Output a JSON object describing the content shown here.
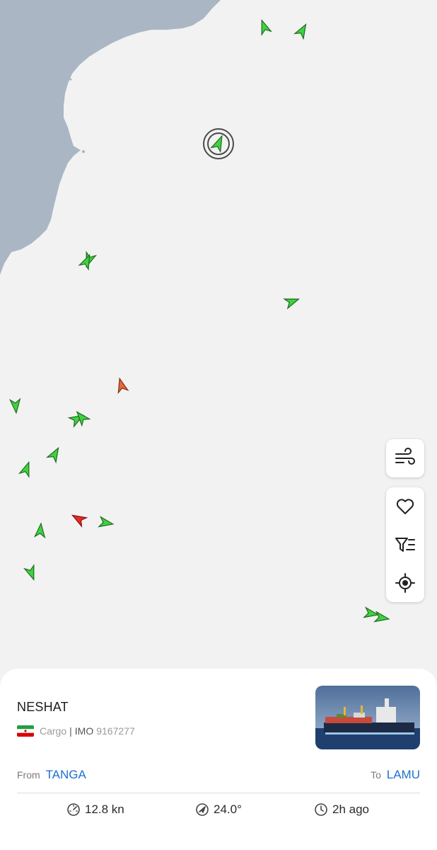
{
  "map": {
    "selected_vessel_marker": "selected-vessel-marker"
  },
  "controls": {
    "wind": "wind-icon",
    "favorite": "heart-icon",
    "filter": "filter-icon",
    "locate": "locate-icon"
  },
  "vessel": {
    "name": "NESHAT",
    "flag": "iran-flag-icon",
    "type": "Cargo",
    "separator": "|",
    "imo_label": "IMO",
    "imo": "9167277",
    "from_label": "From",
    "from_port": "TANGA",
    "to_label": "To",
    "to_port": "LAMU",
    "speed": "12.8 kn",
    "course": "24.0°",
    "last_seen": "2h ago"
  },
  "colors": {
    "ship_green": "#3fd23f",
    "ship_orange": "#e0683c",
    "ship_red": "#e62a2a",
    "link_blue": "#1e6fd0",
    "land": "#aab6c3",
    "sea": "#f2f2f2"
  }
}
